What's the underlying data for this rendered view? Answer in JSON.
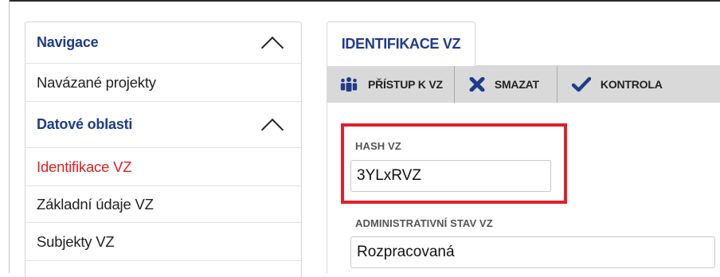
{
  "navigation": {
    "title": "Navigace",
    "linked_projects": "Navázané projekty",
    "data_areas_title": "Datové oblasti",
    "items": [
      {
        "label": "Identifikace VZ",
        "active": true
      },
      {
        "label": "Základní údaje VZ",
        "active": false
      },
      {
        "label": "Subjekty VZ",
        "active": false
      }
    ]
  },
  "tab": {
    "label": "IDENTIFIKACE VZ"
  },
  "toolbar": {
    "access_label": "PŘÍSTUP K VZ",
    "delete_label": "SMAZAT",
    "check_label": "KONTROLA"
  },
  "form": {
    "hash_label": "HASH VZ",
    "hash_value": "3YLxRVZ",
    "status_label": "ADMINISTRATIVNÍ STAV VZ",
    "status_value": "Rozpracovaná"
  },
  "colors": {
    "nav_header": "#1e3c8a",
    "active_item": "#e02020",
    "highlight_box": "#e0202a",
    "toolbar_bg": "#d9d9d9"
  }
}
